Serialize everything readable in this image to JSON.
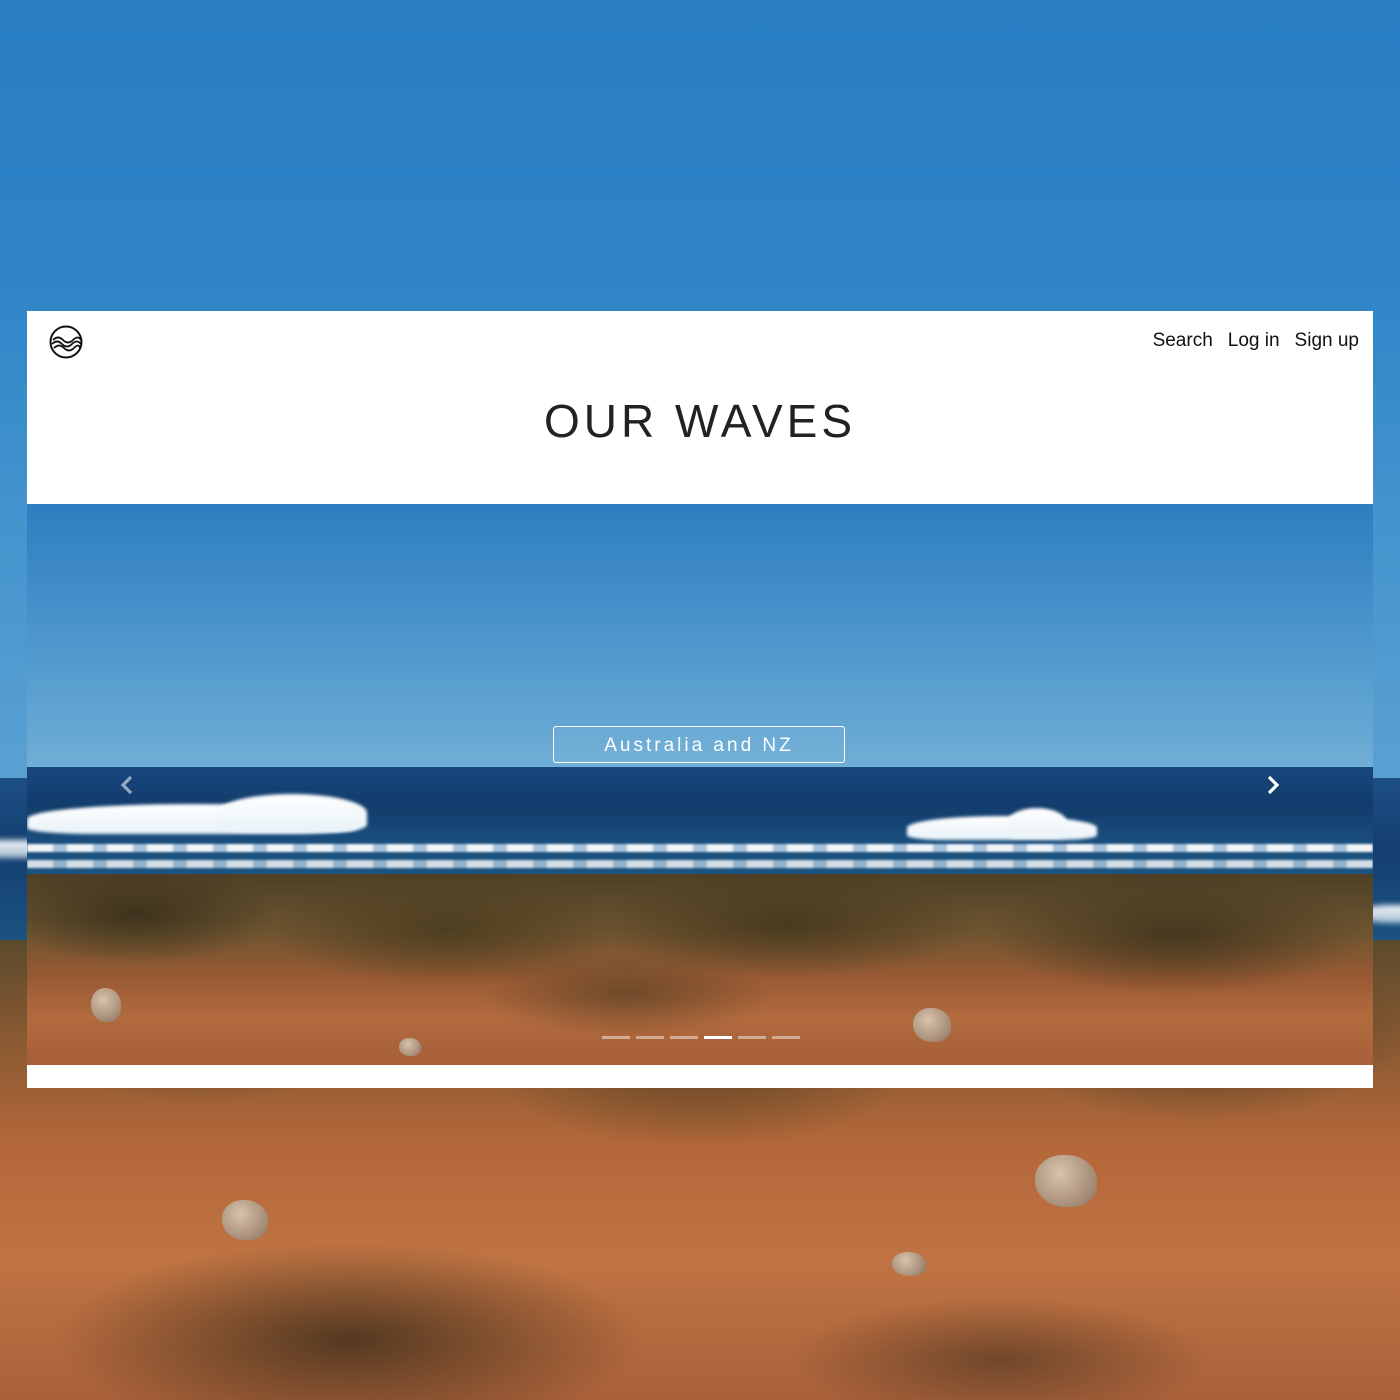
{
  "header": {
    "logo_icon": "waves-circle-logo-icon",
    "nav": [
      {
        "label": "Search"
      },
      {
        "label": "Log in"
      },
      {
        "label": "Sign up"
      }
    ]
  },
  "page": {
    "title": "OUR WAVES"
  },
  "carousel": {
    "slide_label": "Australia and NZ",
    "prev_icon": "chevron-left-icon",
    "next_icon": "chevron-right-icon",
    "indicator_count": 6,
    "active_indicator": 4
  },
  "colors": {
    "card_background": "#ffffff",
    "title_text": "#222222",
    "nav_text": "#111111",
    "button_border": "#ffffff"
  }
}
